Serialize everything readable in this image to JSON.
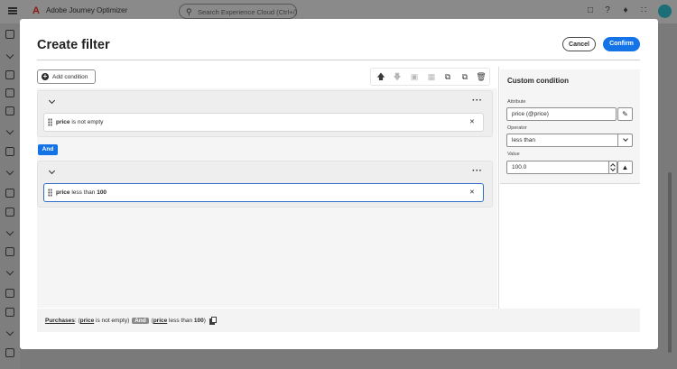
{
  "app": {
    "name": "Adobe Journey Optimizer",
    "search_placeholder": "Search Experience Cloud (Ctrl+/)"
  },
  "modal": {
    "title": "Create filter",
    "cancel_label": "Cancel",
    "confirm_label": "Confirm",
    "add_condition_label": "Add condition"
  },
  "toolbar": {
    "icons": [
      "move-up-icon",
      "move-down-icon",
      "group-icon",
      "ungroup-icon",
      "duplicate-icon",
      "copy-icon",
      "delete-icon"
    ]
  },
  "groups": [
    {
      "condition": {
        "attribute": "price",
        "operator": "is not empty",
        "value": ""
      }
    },
    {
      "condition": {
        "attribute": "price",
        "operator": "less than",
        "value": "100"
      }
    }
  ],
  "connector": "And",
  "panel": {
    "title": "Custom condition",
    "attribute_label": "Attribute",
    "attribute_value": "price (@price)",
    "operator_label": "Operator",
    "operator_value": "less than",
    "value_label": "Value",
    "value_value": "100.0"
  },
  "summary": {
    "entity": "Purchases",
    "sep": ": (",
    "cond1_attr": "price",
    "cond1_op": "is not empty)",
    "and": "And",
    "open2": "(",
    "cond2_attr": "price",
    "cond2_op": "less than",
    "cond2_val": "100",
    "close2": ")"
  },
  "colors": {
    "accent": "#1473e6",
    "selected_border": "#2d6bc4"
  }
}
